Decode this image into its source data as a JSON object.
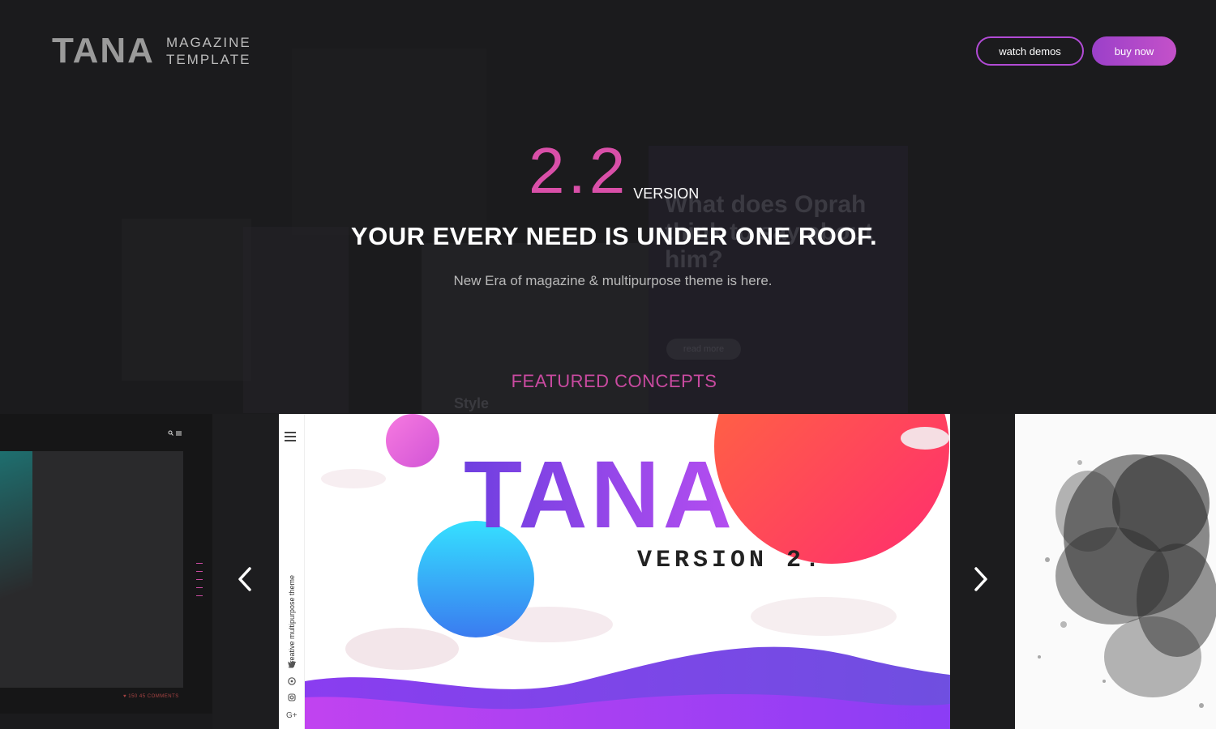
{
  "header": {
    "logo_main": "TANA",
    "logo_sub_line1": "MAGAZINE",
    "logo_sub_line2": "TEMPLATE",
    "watch_demos_label": "watch demos",
    "buy_now_label": "buy now"
  },
  "hero": {
    "version_number": "2.2",
    "version_word": "VERSION",
    "headline": "YOUR EVERY NEED IS UNDER ONE ROOF.",
    "subline": "New Era of magazine & multipurpose theme is here.",
    "featured_label": "FEATURED CONCEPTS"
  },
  "background": {
    "ghost_title": "What does Oprah think to say about him?",
    "ghost_read_more": "read more",
    "ghost_style": "Style"
  },
  "carousel": {
    "center": {
      "title": "TANA",
      "subtitle": "VERSION 2.",
      "vertical_text": "Creative multipurpose theme",
      "social_icons": [
        "twitter-icon",
        "pinterest-icon",
        "instagram-icon",
        "google-plus-icon"
      ]
    },
    "left": {
      "meta": "♥ 150   45 COMMENTS"
    }
  },
  "colors": {
    "accent_pink": "#d94fa8",
    "accent_purple": "#9b40c9",
    "background": "#1b1b1d"
  }
}
